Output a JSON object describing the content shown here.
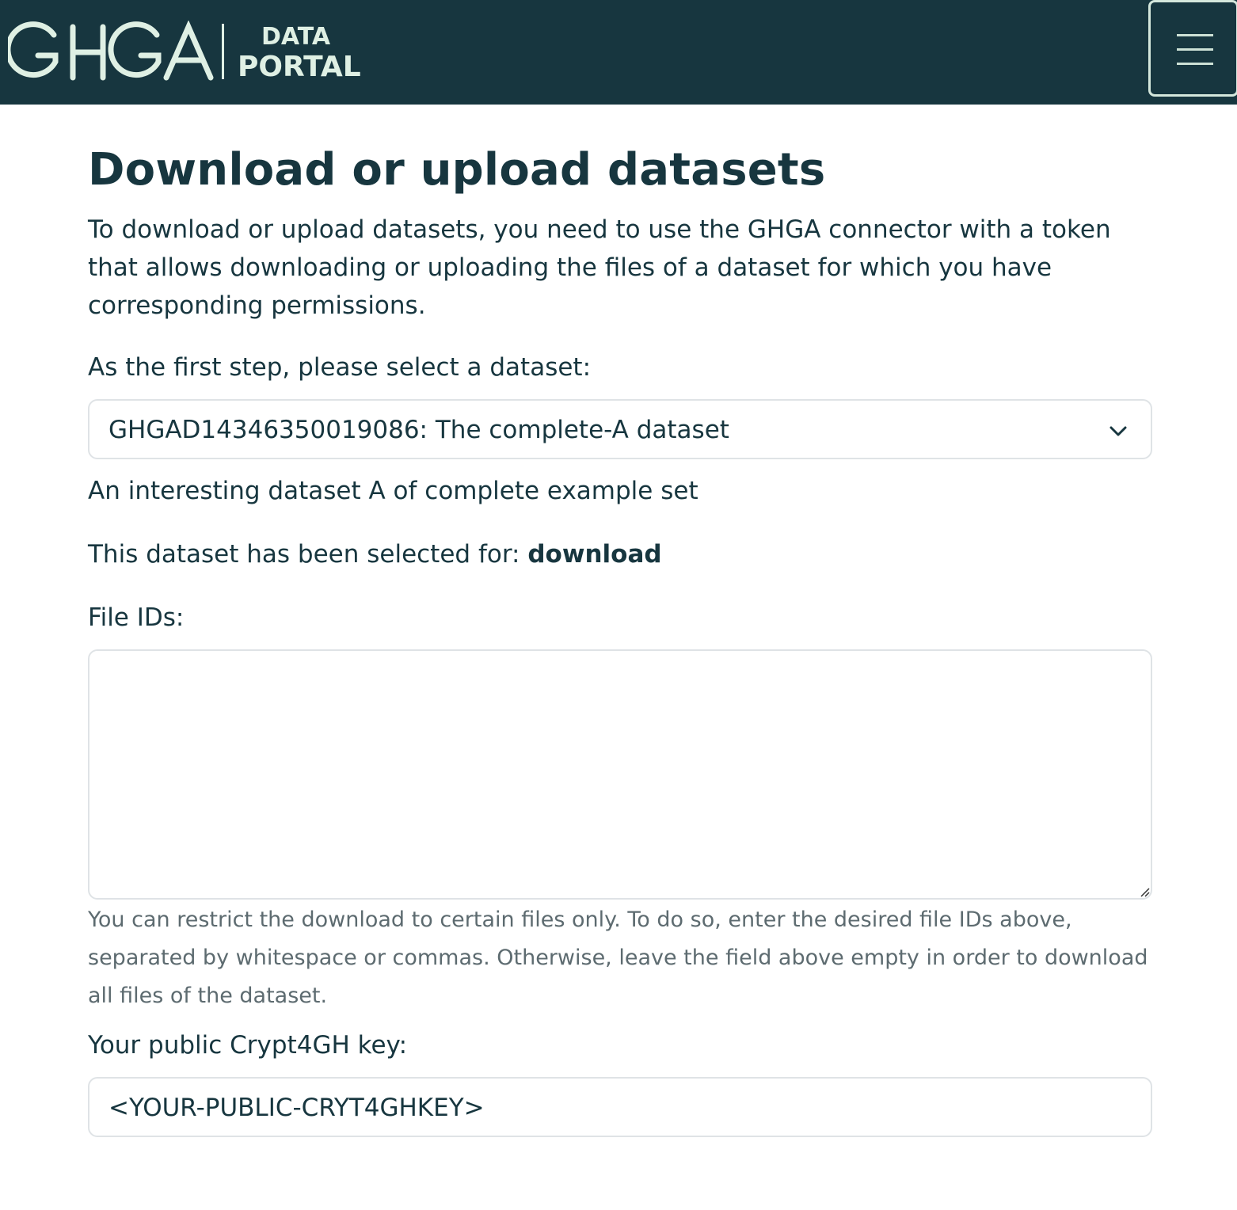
{
  "header": {
    "logo_text": "GHGA",
    "logo_sub_line1": "DATA",
    "logo_sub_line2": "PORTAL",
    "menu_icon": "hamburger-icon"
  },
  "main": {
    "title": "Download or upload datasets",
    "intro": "To download or upload datasets, you need to use the GHGA connector with a token that allows downloading or uploading the files of a dataset for which you have corresponding permissions.",
    "select_label": "As the first step, please select a dataset:",
    "selected_dataset": "GHGAD14346350019086: The complete-A dataset",
    "dataset_description": "An interesting dataset A of complete example set",
    "selected_for_prefix": "This dataset has been selected for: ",
    "selected_for_value": "download",
    "file_ids_label": "File IDs:",
    "file_ids_value": "",
    "file_ids_help": "You can restrict the download to certain files only. To do so, enter the desired file IDs above, separated by whitespace or commas. Otherwise, leave the field above empty in order to download all files of the dataset.",
    "key_label": "Your public Crypt4GH key:",
    "key_value": "<YOUR-PUBLIC-CRYT4GHKEY>"
  },
  "colors": {
    "navbar_bg": "#17363f",
    "logo": "#dff0e4",
    "text": "#17363f",
    "muted": "#5d6b70"
  }
}
